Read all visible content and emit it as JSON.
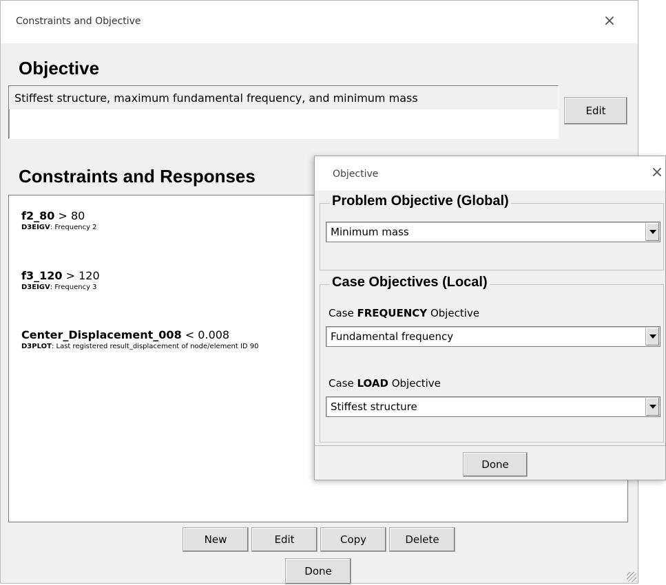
{
  "main_window": {
    "title": "Constraints and Objective",
    "close_glyph": "×",
    "objective_heading": "Objective",
    "objective_text": "Stiffest structure, maximum fundamental frequency, and minimum mass",
    "objective_edit_label": "Edit",
    "constraints_heading": "Constraints and Responses",
    "constraints": [
      {
        "name": "f2_80",
        "op": ">",
        "value": "80",
        "source": "D3EIGV",
        "desc": "Frequency 2"
      },
      {
        "name": "f3_120",
        "op": ">",
        "value": "120",
        "source": "D3EIGV",
        "desc": "Frequency 3"
      },
      {
        "name": "Center_Displacement_008",
        "op": "<",
        "value": "0.008",
        "source": "D3PLOT",
        "desc": "Last registered result_displacement of node/element ID 90"
      }
    ],
    "buttons": {
      "new": "New",
      "edit": "Edit",
      "copy": "Copy",
      "delete": "Delete",
      "done": "Done"
    }
  },
  "objective_dialog": {
    "title": "Objective",
    "close_glyph": "×",
    "problem_group_title": "Problem Objective (Global)",
    "problem_selected": "Minimum mass",
    "case_group_title": "Case Objectives (Local)",
    "case_word": "Case",
    "objective_word": "Objective",
    "cases": [
      {
        "name": "FREQUENCY",
        "selected": "Fundamental frequency"
      },
      {
        "name": "LOAD",
        "selected": "Stiffest structure"
      }
    ],
    "done_label": "Done"
  },
  "icons": {
    "close": "close-icon",
    "dropdown": "chevron-down-icon",
    "resize": "resize-grip-icon"
  }
}
